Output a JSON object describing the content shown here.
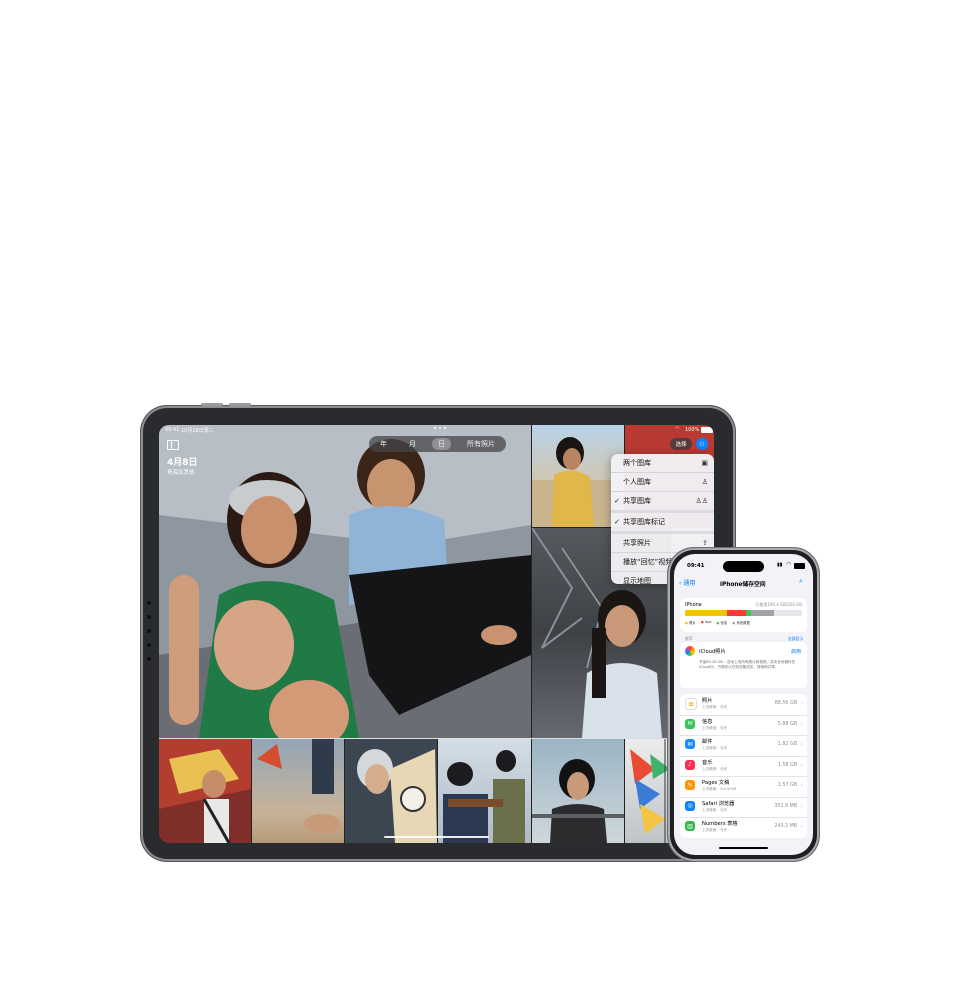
{
  "ipad": {
    "status_time": "09:41",
    "status_date": "10月18日周二",
    "status_battery": "100%",
    "header_date": "4月8日",
    "header_place": "青海及其他",
    "segments": [
      "年",
      "月",
      "日",
      "所有照片"
    ],
    "active_segment": "日",
    "select_button": "选择",
    "menu": [
      {
        "label": "两个图库",
        "checked": false,
        "icon": "▣"
      },
      {
        "label": "个人图库",
        "checked": false,
        "icon": "♙"
      },
      {
        "label": "共享图库",
        "checked": true,
        "icon": "♙♙"
      },
      {
        "label": "共享图库标记",
        "checked": true,
        "icon": ""
      },
      {
        "label": "共享照片",
        "checked": false,
        "icon": "⇪"
      },
      {
        "label": "播放“回忆”视频",
        "checked": false,
        "icon": "▶"
      },
      {
        "label": "显示地图",
        "checked": false,
        "icon": "▦"
      }
    ]
  },
  "iphone": {
    "status_time": "09:41",
    "back_label": "通用",
    "title": "iPhone储存空间",
    "device_label": "iPhone",
    "usage_text": "已使用194.4 GB/256 GB",
    "legend": [
      {
        "label": "照片",
        "color": "#f5c400"
      },
      {
        "label": "App",
        "color": "#ff3b30"
      },
      {
        "label": "信息",
        "color": "#34c759"
      },
      {
        "label": "系统数据",
        "color": "#a1a1a6"
      }
    ],
    "recommend_label": "推荐",
    "show_all_label": "全部显示",
    "icloud_title": "iCloud照片",
    "icloud_action": "启用",
    "icloud_desc": "节省85.28 GB – 自动上传所有照片和视频，并安全地储存在iCloud中，方便你以任何设备浏览、搜索和共享。",
    "apps": [
      {
        "name": "照片",
        "sub": "上次使用：今天",
        "size": "88.56 GB",
        "color": "#ffffff",
        "glyph": "✿"
      },
      {
        "name": "信息",
        "sub": "上次使用：今天",
        "size": "5.88 GB",
        "color": "#34c759",
        "glyph": "✉"
      },
      {
        "name": "邮件",
        "sub": "上次使用：今天",
        "size": "1.82 GB",
        "color": "#1a8cff",
        "glyph": "✉"
      },
      {
        "name": "音乐",
        "sub": "上次使用：今天",
        "size": "1.58 GB",
        "color": "#ff2d55",
        "glyph": "♪"
      },
      {
        "name": "Pages 文稿",
        "sub": "上次使用：2023/9/8",
        "size": "1.57 GB",
        "color": "#ff9500",
        "glyph": "✎"
      },
      {
        "name": "Safari 浏览器",
        "sub": "上次使用：今天",
        "size": "352.9 MB",
        "color": "#0a84ff",
        "glyph": "◎"
      },
      {
        "name": "Numbers 表格",
        "sub": "上次使用：今天",
        "size": "243.2 MB",
        "color": "#30b94a",
        "glyph": "▥"
      }
    ]
  },
  "colors": {
    "accent": "#007aff",
    "ipad_frame": "#2a2b2e",
    "iphone_frame": "#1e1f22"
  }
}
